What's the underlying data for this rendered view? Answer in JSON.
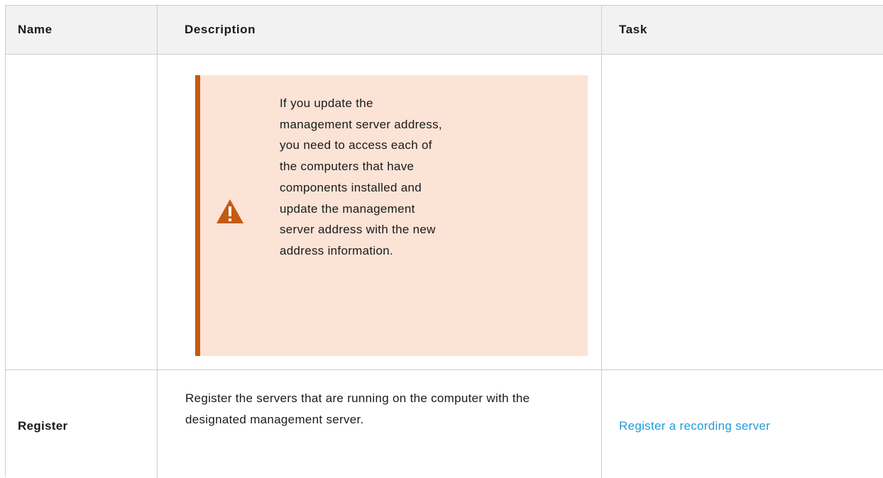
{
  "table": {
    "headers": {
      "name": "Name",
      "description": "Description",
      "task": "Task"
    },
    "warning": {
      "icon": "warning-triangle-icon",
      "accent_color": "#c55a11",
      "background_color": "#fbe3d6",
      "text": "If you update the management server address, you need to access each of the computers that have components installed and update the management server address with the new address information."
    },
    "rows": [
      {
        "name": "Register",
        "description": "Register the servers that are running on the computer with the designated management server.",
        "task_link": "Register a recording server",
        "link_color": "#1d9bd8"
      }
    ]
  }
}
